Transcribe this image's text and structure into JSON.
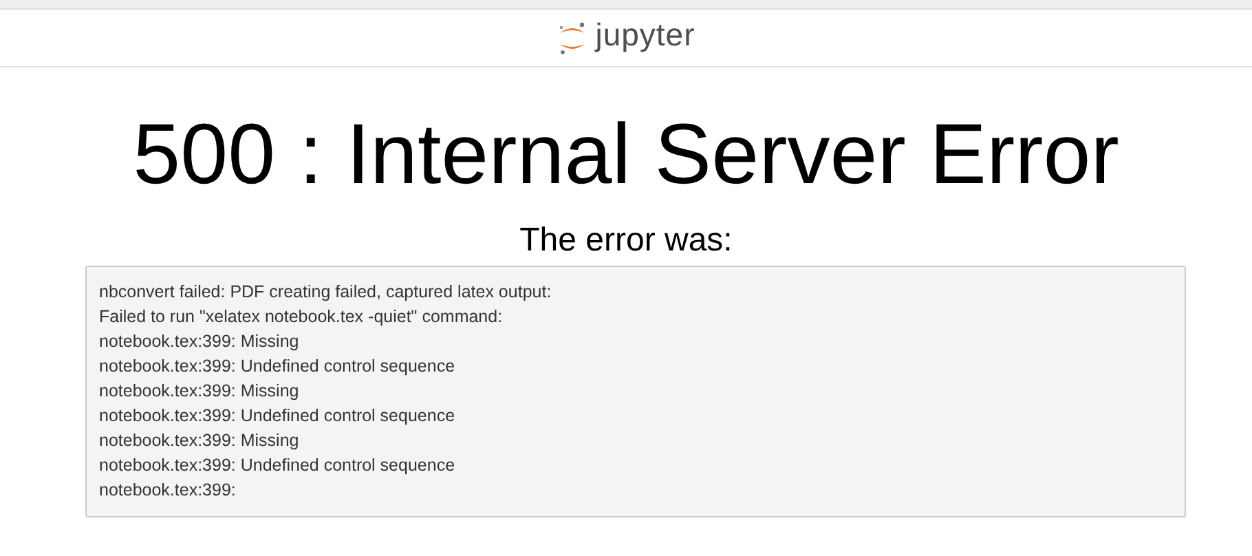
{
  "header": {
    "logo_text": "jupyter"
  },
  "error": {
    "title": "500 : Internal Server Error",
    "subtitle": "The error was:",
    "lines": [
      "nbconvert failed: PDF creating failed, captured latex output:",
      "Failed to run \"xelatex notebook.tex -quiet\" command:",
      "notebook.tex:399: Missing",
      "notebook.tex:399: Undefined control sequence",
      "notebook.tex:399: Missing",
      "notebook.tex:399: Undefined control sequence",
      "notebook.tex:399: Missing",
      "notebook.tex:399: Undefined control sequence",
      "notebook.tex:399:"
    ]
  }
}
